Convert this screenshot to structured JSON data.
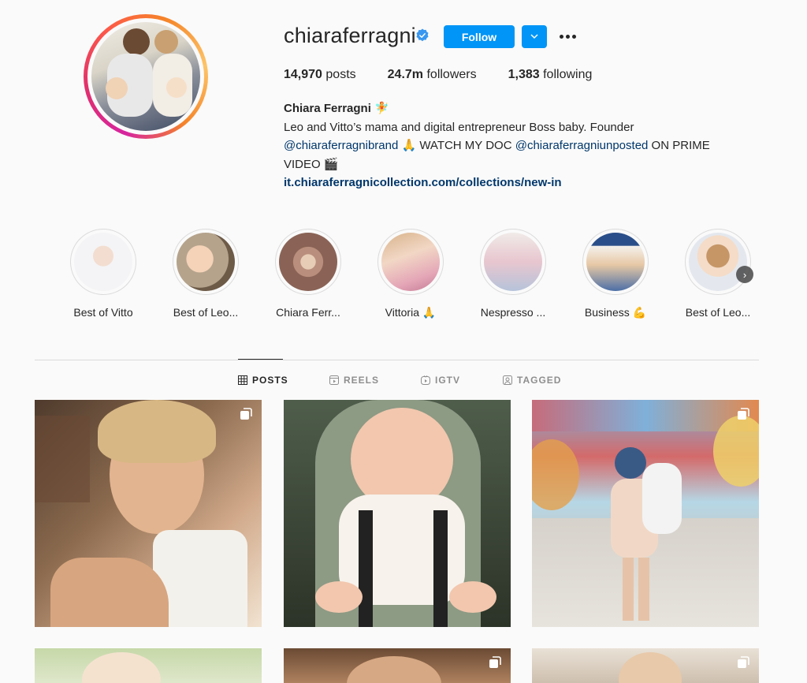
{
  "profile": {
    "username": "chiaraferragni",
    "follow_label": "Follow",
    "dropdown_icon": "chevron-down-icon",
    "more_icon": "more-options-icon",
    "verified": true
  },
  "stats": {
    "posts_count": "14,970",
    "posts_label": "posts",
    "followers_count": "24.7m",
    "followers_label": "followers",
    "following_count": "1,383",
    "following_label": "following"
  },
  "bio": {
    "name": "Chiara Ferragni",
    "name_emoji": "🧚",
    "line1": "Leo and Vitto’s mama and digital entrepreneur Boss baby. Founder",
    "mention1": "@chiaraferragnibrand",
    "text2": " 🙏 WATCH MY DOC ",
    "mention2": "@chiaraferragniunposted",
    "text3": " ON PRIME",
    "text4": "VIDEO 🎬",
    "link": "it.chiaraferragnicollection.com/collections/new-in"
  },
  "highlights": [
    {
      "label": "Best of Vitto"
    },
    {
      "label": "Best of Leo..."
    },
    {
      "label": "Chiara Ferr..."
    },
    {
      "label": "Vittoria 🙏"
    },
    {
      "label": "Nespresso ..."
    },
    {
      "label": "Business 💪"
    },
    {
      "label": "Best of Leo..."
    }
  ],
  "highlight_next_icon": "chevron-right-icon",
  "tabs": [
    {
      "label": "POSTS",
      "icon": "grid-icon",
      "active": true
    },
    {
      "label": "REELS",
      "icon": "reels-icon",
      "active": false
    },
    {
      "label": "IGTV",
      "icon": "igtv-icon",
      "active": false
    },
    {
      "label": "TAGGED",
      "icon": "tagged-icon",
      "active": false
    }
  ],
  "colors": {
    "primary_button": "#0095f6",
    "link": "#00376b",
    "text": "#262626",
    "muted": "#8e8e8e",
    "background": "#fafafa"
  }
}
